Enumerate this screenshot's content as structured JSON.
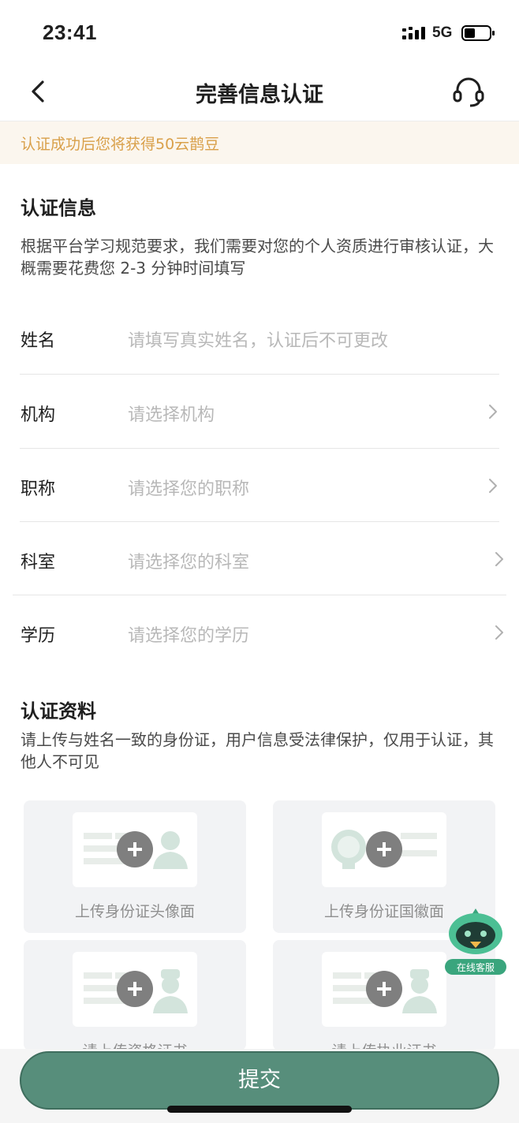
{
  "status_bar": {
    "time": "23:41",
    "network": "5G"
  },
  "nav": {
    "title": "完善信息认证"
  },
  "notice": {
    "text": "认证成功后您将获得50云鹊豆"
  },
  "info_section": {
    "title": "认证信息",
    "description": "根据平台学习规范要求，我们需要对您的个人资质进行审核认证，大概需要花费您 2-3 分钟时间填写"
  },
  "form": {
    "rows": [
      {
        "label": "姓名",
        "placeholder": "请填写真实姓名，认证后不可更改"
      },
      {
        "label": "机构",
        "placeholder": "请选择机构"
      },
      {
        "label": "职称",
        "placeholder": "请选择您的职称"
      },
      {
        "label": "科室",
        "placeholder": "请选择您的科室"
      },
      {
        "label": "学历",
        "placeholder": "请选择您的学历"
      }
    ]
  },
  "docs_section": {
    "title": "认证资料",
    "description": "请上传与姓名一致的身份证，用户信息受法律保护，仅用于认证，其他人不可见"
  },
  "uploads": [
    {
      "label": "上传身份证头像面",
      "icon": "id-card-portrait-icon"
    },
    {
      "label": "上传身份证国徽面",
      "icon": "id-card-emblem-icon"
    },
    {
      "label": "请上传资格证书",
      "icon": "qualification-certificate-icon"
    },
    {
      "label": "请上传执业证书",
      "icon": "practice-certificate-icon"
    }
  ],
  "assistant": {
    "label": "在线客服"
  },
  "submit": {
    "label": "提交"
  },
  "colors": {
    "accent": "#578e7b",
    "notice_text": "#d9a04a",
    "notice_bg": "#fbf6ee"
  }
}
